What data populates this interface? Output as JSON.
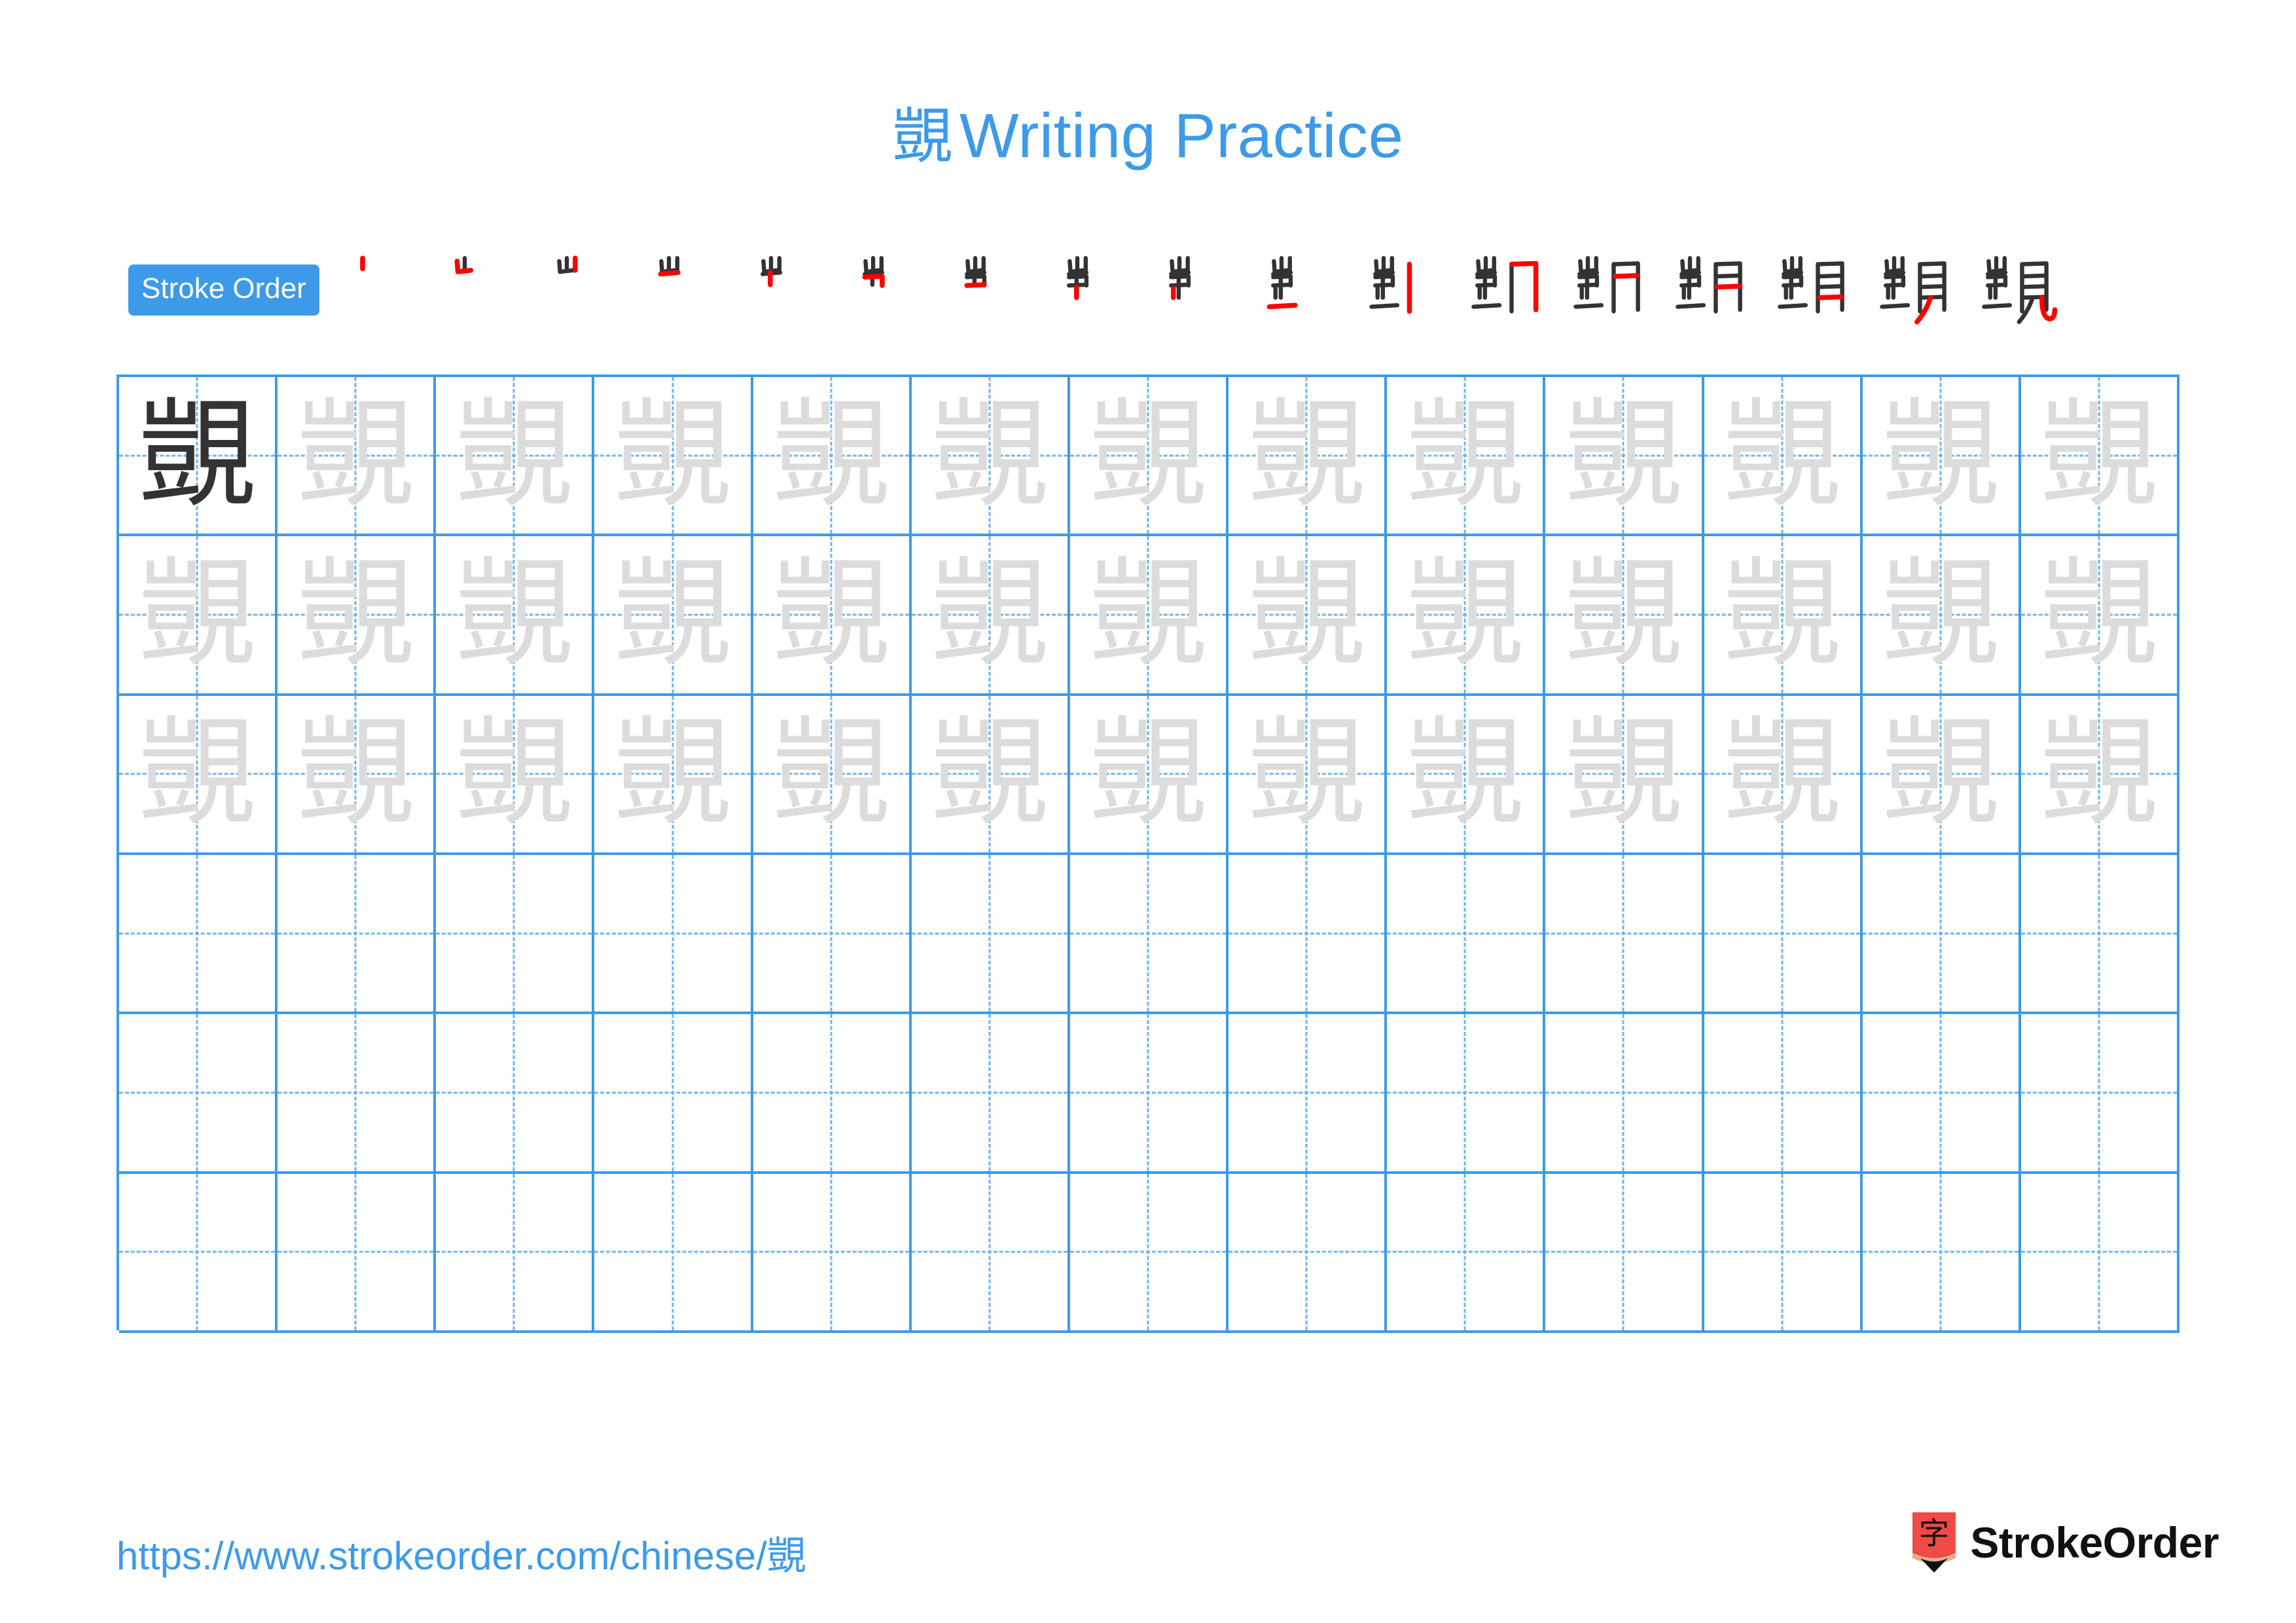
{
  "character": "覬",
  "header": {
    "title_character": "覬",
    "title_text": "Writing Practice",
    "title_color": "#3d9ae8"
  },
  "stroke_order": {
    "badge_label": "Stroke Order",
    "badge_bg": "#3d9ae8",
    "badge_text_color": "#ffffff",
    "total_strokes": 17,
    "new_stroke_color": "#ff0000",
    "existing_stroke_color": "#333333",
    "steps": [
      {
        "index": 1,
        "partial": "丨",
        "new_stroke": "vertical"
      },
      {
        "index": 2,
        "partial": "屵",
        "new_stroke": "vertical-turn-horizontal"
      },
      {
        "index": 3,
        "partial": "山",
        "new_stroke": "vertical"
      },
      {
        "index": 4,
        "partial": "屮",
        "new_stroke": "horizontal"
      },
      {
        "index": 5,
        "partial": "屵",
        "new_stroke": "vertical"
      },
      {
        "index": 6,
        "partial": "屵",
        "new_stroke": "horizontal-turn"
      },
      {
        "index": 7,
        "partial": "岂",
        "new_stroke": "horizontal"
      },
      {
        "index": 8,
        "partial": "岂",
        "new_stroke": "vertical"
      },
      {
        "index": 9,
        "partial": "岂",
        "new_stroke": "vertical"
      },
      {
        "index": 10,
        "partial": "豈",
        "new_stroke": "horizontal-base"
      },
      {
        "index": 11,
        "partial": "剀",
        "new_stroke": "vertical"
      },
      {
        "index": 12,
        "partial": "覬",
        "new_stroke": "horizontal-fold-vertical"
      },
      {
        "index": 13,
        "partial": "覬",
        "new_stroke": "horizontal"
      },
      {
        "index": 14,
        "partial": "覬",
        "new_stroke": "horizontal"
      },
      {
        "index": 15,
        "partial": "覬",
        "new_stroke": "horizontal"
      },
      {
        "index": 16,
        "partial": "覬",
        "new_stroke": "left-falling"
      },
      {
        "index": 17,
        "partial": "覬",
        "new_stroke": "vertical-curve-hook"
      }
    ]
  },
  "practice_grid": {
    "columns": 13,
    "rows": 6,
    "border_color": "#3d9ae8",
    "guide_color": "#6fb4ef",
    "dark_char_color": "#333333",
    "trace_char_color": "#dcdcdc",
    "cells": [
      [
        "dark",
        "trace",
        "trace",
        "trace",
        "trace",
        "trace",
        "trace",
        "trace",
        "trace",
        "trace",
        "trace",
        "trace",
        "trace"
      ],
      [
        "trace",
        "trace",
        "trace",
        "trace",
        "trace",
        "trace",
        "trace",
        "trace",
        "trace",
        "trace",
        "trace",
        "trace",
        "trace"
      ],
      [
        "trace",
        "trace",
        "trace",
        "trace",
        "trace",
        "trace",
        "trace",
        "trace",
        "trace",
        "trace",
        "trace",
        "trace",
        "trace"
      ],
      [
        "empty",
        "empty",
        "empty",
        "empty",
        "empty",
        "empty",
        "empty",
        "empty",
        "empty",
        "empty",
        "empty",
        "empty",
        "empty"
      ],
      [
        "empty",
        "empty",
        "empty",
        "empty",
        "empty",
        "empty",
        "empty",
        "empty",
        "empty",
        "empty",
        "empty",
        "empty",
        "empty"
      ],
      [
        "empty",
        "empty",
        "empty",
        "empty",
        "empty",
        "empty",
        "empty",
        "empty",
        "empty",
        "empty",
        "empty",
        "empty",
        "empty"
      ]
    ]
  },
  "footer": {
    "url": "https://www.strokeorder.com/chinese/覬",
    "url_color": "#3d9ae8",
    "logo_glyph": "字",
    "logo_badge_color": "#ef4a46",
    "logo_wood_color": "#dbb48c",
    "logo_tip_color": "#111111",
    "brand_name": "StrokeOrder"
  }
}
